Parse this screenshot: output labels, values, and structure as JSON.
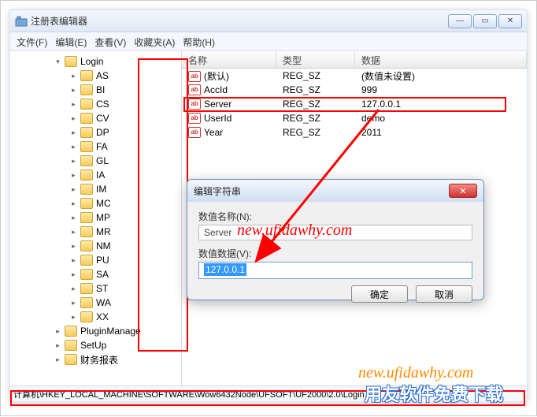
{
  "window": {
    "title": "注册表编辑器",
    "menu": {
      "file": "文件(F)",
      "edit": "编辑(E)",
      "view": "查看(V)",
      "fav": "收藏夹(A)",
      "help": "帮助(H)"
    }
  },
  "tree": {
    "root_label": "Login",
    "nodes": [
      "AS",
      "BI",
      "CS",
      "CV",
      "DP",
      "FA",
      "GL",
      "IA",
      "IM",
      "MC",
      "MP",
      "MR",
      "NM",
      "PU",
      "SA",
      "ST",
      "WA",
      "XX"
    ],
    "siblings": [
      "PluginManage",
      "SetUp",
      "财务报表"
    ]
  },
  "list": {
    "headers": {
      "name": "名称",
      "type": "类型",
      "data": "数据"
    },
    "rows": [
      {
        "name": "(默认)",
        "type": "REG_SZ",
        "data": "(数值未设置)"
      },
      {
        "name": "AccId",
        "type": "REG_SZ",
        "data": "999"
      },
      {
        "name": "Server",
        "type": "REG_SZ",
        "data": "127.0.0.1"
      },
      {
        "name": "UserId",
        "type": "REG_SZ",
        "data": "demo"
      },
      {
        "name": "Year",
        "type": "REG_SZ",
        "data": "2011"
      }
    ]
  },
  "dialog": {
    "title": "编辑字符串",
    "label_name": "数值名称(N):",
    "name": "Server",
    "label_value": "数值数据(V):",
    "value": "127.0.0.1",
    "ok": "确定",
    "cancel": "取消"
  },
  "status": "计算机\\HKEY_LOCAL_MACHINE\\SOFTWARE\\Wow6432Node\\UFSOFT\\UF2000\\2.0\\Login",
  "watermark1": "new.ufidawhy.com",
  "watermark2": "new.ufidawhy.com",
  "watermark3": "用友软件免费下载"
}
